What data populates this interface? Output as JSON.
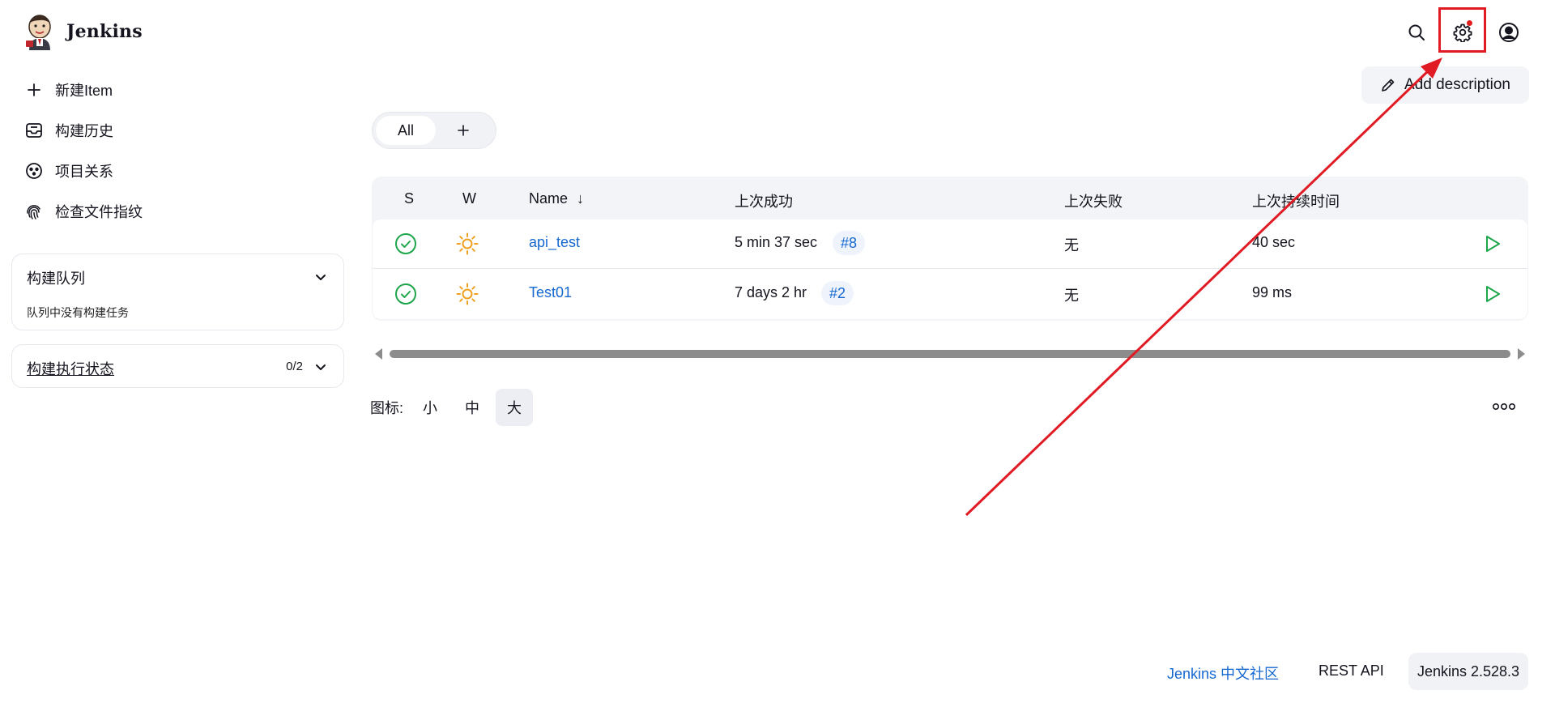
{
  "header": {
    "brand_name": "Jenkins",
    "icons": {
      "search": "search-icon",
      "settings": "gear-icon",
      "user": "user-icon"
    }
  },
  "sidebar": {
    "items": [
      {
        "label": "新建Item",
        "icon": "plus-icon"
      },
      {
        "label": "构建历史",
        "icon": "inbox-icon"
      },
      {
        "label": "项目关系",
        "icon": "relationship-icon"
      },
      {
        "label": "检查文件指纹",
        "icon": "fingerprint-icon"
      }
    ],
    "queue": {
      "title": "构建队列",
      "empty_text": "队列中没有构建任务"
    },
    "executors": {
      "title": "构建执行状态",
      "count": "0/2"
    }
  },
  "main": {
    "add_description_label": "Add description",
    "tabs": {
      "all_label": "All",
      "add_label": "+"
    },
    "table": {
      "headers": {
        "s": "S",
        "w": "W",
        "name": "Name",
        "name_sort": "↓",
        "last_success": "上次成功",
        "last_failure": "上次失败",
        "last_duration": "上次持续时间"
      },
      "rows": [
        {
          "name": "api_test",
          "last_success": "5 min 37 sec",
          "build": "#8",
          "last_failure": "无",
          "last_duration": "40 sec",
          "status": "success",
          "weather": "sunny"
        },
        {
          "name": "Test01",
          "last_success": "7 days 2 hr",
          "build": "#2",
          "last_failure": "无",
          "last_duration": "99 ms",
          "status": "success",
          "weather": "sunny"
        }
      ]
    },
    "icon_size": {
      "label": "图标:",
      "options": [
        "小",
        "中",
        "大"
      ],
      "selected": "大"
    }
  },
  "footer": {
    "community_link": "Jenkins 中文社区",
    "rest_api": "REST API",
    "version": "Jenkins 2.528.3"
  },
  "colors": {
    "accent": "#1668d1",
    "success": "#1ea64a",
    "weather": "#f0a020",
    "annotation": "#e01b24"
  }
}
